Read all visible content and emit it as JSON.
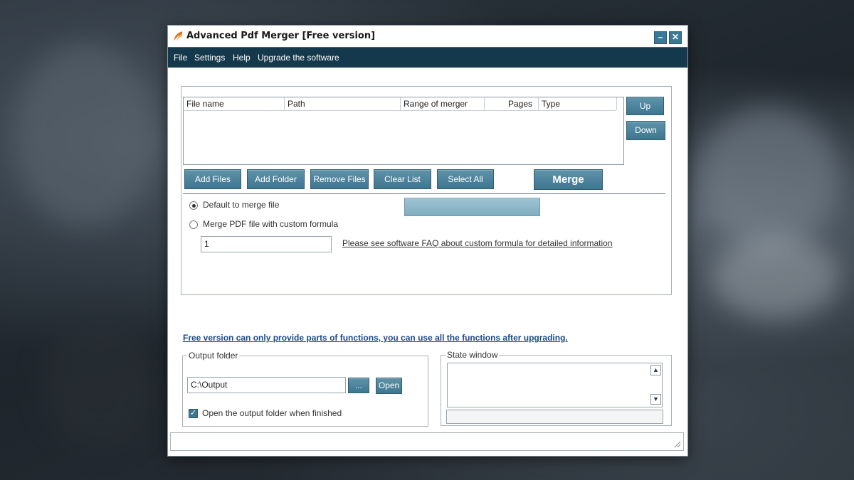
{
  "window": {
    "title": "Advanced Pdf Merger [Free version]",
    "minimize_symbol": "–",
    "close_symbol": "✕"
  },
  "menu": [
    "File",
    "Settings",
    "Help",
    "Upgrade the software"
  ],
  "file_list": {
    "columns": [
      "File name",
      "Path",
      "Range of merger",
      "Pages",
      "Type"
    ],
    "rows": []
  },
  "buttons": {
    "up": "Up",
    "down": "Down",
    "add_files": "Add Files",
    "add_folder": "Add Folder",
    "remove_files": "Remove Files",
    "clear_list": "Clear List",
    "select_all": "Select All",
    "merge": "Merge",
    "browse": "...",
    "open": "Open"
  },
  "options": {
    "default_merge": "Default to merge file",
    "custom_formula": "Merge PDF file with custom formula",
    "selected": "default_merge",
    "formula_value": "1",
    "faq_link": "Please see software FAQ about custom formula for detailed information"
  },
  "notice": "Free version can only provide parts of functions, you can use all the functions after upgrading.",
  "output": {
    "legend": "Output folder",
    "path": "C:\\Output",
    "open_when_finished_label": "Open the output folder when finished",
    "open_when_finished": true
  },
  "state": {
    "legend": "State window"
  },
  "colors": {
    "accent": "#3e7690",
    "menubar": "#15394c",
    "notice": "#1b4a8a"
  },
  "icons": {
    "app": "pdf-merger-logo-icon",
    "scroll_up": "▲",
    "scroll_down": "▼",
    "check": "✓",
    "resize_grip": "resize-grip-icon"
  }
}
